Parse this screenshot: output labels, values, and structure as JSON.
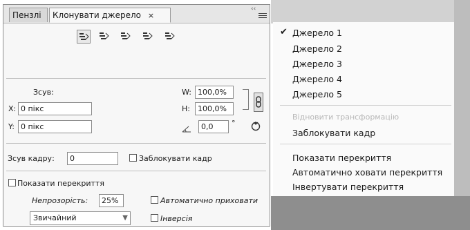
{
  "panel": {
    "tabs": [
      {
        "label": "Пензлі"
      },
      {
        "label": "Клонувати джерело",
        "close": "×"
      }
    ],
    "collapse_glyph": "‹‹",
    "source_buttons": [
      {
        "icon": "clone-source-1-icon",
        "selected": true
      },
      {
        "icon": "clone-source-2-icon"
      },
      {
        "icon": "clone-source-3-icon"
      },
      {
        "icon": "clone-source-4-icon"
      },
      {
        "icon": "clone-source-5-icon"
      }
    ],
    "offset": {
      "label": "Зсув:",
      "x_label": "X:",
      "x_value": "0 пікс",
      "y_label": "Y:",
      "y_value": "0 пікс",
      "w_label": "W:",
      "w_value": "100,0%",
      "h_label": "H:",
      "h_value": "100,0%",
      "angle_value": "0,0",
      "degree_symbol": "°"
    },
    "frame_offset": {
      "label": "Зсув кадру:",
      "value": "0",
      "lock_frame_label": "Заблокувати кадр"
    },
    "overlay": {
      "show_label": "Показати перекриття",
      "opacity_label": "Непрозорість:",
      "opacity_value": "25%",
      "auto_hide_label": "Автоматично приховати",
      "blend_mode": "Звичайний",
      "invert_label": "Інверсія"
    }
  },
  "menu": {
    "items": [
      {
        "label": "Джерело 1",
        "checked": true
      },
      {
        "label": "Джерело 2"
      },
      {
        "label": "Джерело 3"
      },
      {
        "label": "Джерело 4"
      },
      {
        "label": "Джерело 5"
      },
      {
        "label": "Відновити трансформацію",
        "disabled": true
      },
      {
        "label": "Заблокувати кадр"
      },
      {
        "label": "Показати перекриття"
      },
      {
        "label": "Автоматично ховати перекриття"
      },
      {
        "label": "Інвертувати перекриття"
      }
    ],
    "check_glyph": "✔"
  },
  "colors": {
    "panel_bg": "#f7f7f7",
    "menu_bg": "#fafafa",
    "disabled_text": "#b8b8b8"
  }
}
